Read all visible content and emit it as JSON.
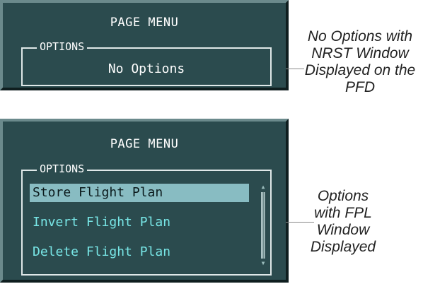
{
  "top_menu": {
    "title": "PAGE MENU",
    "options_label": "OPTIONS",
    "message": "No Options"
  },
  "bottom_menu": {
    "title": "PAGE MENU",
    "options_label": "OPTIONS",
    "items": [
      {
        "label": "Store Flight Plan",
        "selected": true
      },
      {
        "label": "Invert Flight Plan",
        "selected": false
      },
      {
        "label": "Delete Flight Plan",
        "selected": false
      }
    ]
  },
  "callouts": {
    "top": "No Options with NRST Window Displayed on the PFD",
    "bottom": "Options with FPL Window Displayed"
  },
  "colors": {
    "panel_bg": "#2b4b4e",
    "item_text": "#78e6e6",
    "selected_bg": "#88bcc2"
  }
}
